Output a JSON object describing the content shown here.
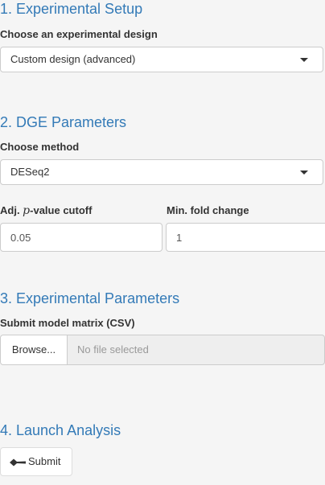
{
  "sections": {
    "setup": {
      "title": "1. Experimental Setup",
      "design_label": "Choose an experimental design",
      "design_value": "Custom design (advanced)"
    },
    "dge": {
      "title": "2. DGE Parameters",
      "method_label": "Choose method",
      "method_value": "DESeq2",
      "pvalue_label_prefix": "Adj. ",
      "pvalue_label_symbol": "p",
      "pvalue_label_suffix": "-value cutoff",
      "pvalue_value": "0.05",
      "fold_label": "Min. fold change",
      "fold_value": "1"
    },
    "params": {
      "title": "3. Experimental Parameters",
      "matrix_label": "Submit model matrix (CSV)",
      "browse_label": "Browse...",
      "file_status": "No file selected"
    },
    "launch": {
      "title": "4. Launch Analysis",
      "submit_label": "Submit",
      "submit_icon": "paper-plane-icon"
    }
  },
  "colors": {
    "heading": "#337ab7",
    "background": "#f5f5f5",
    "border": "#cccccc",
    "file_display_bg": "#eeeeee"
  }
}
